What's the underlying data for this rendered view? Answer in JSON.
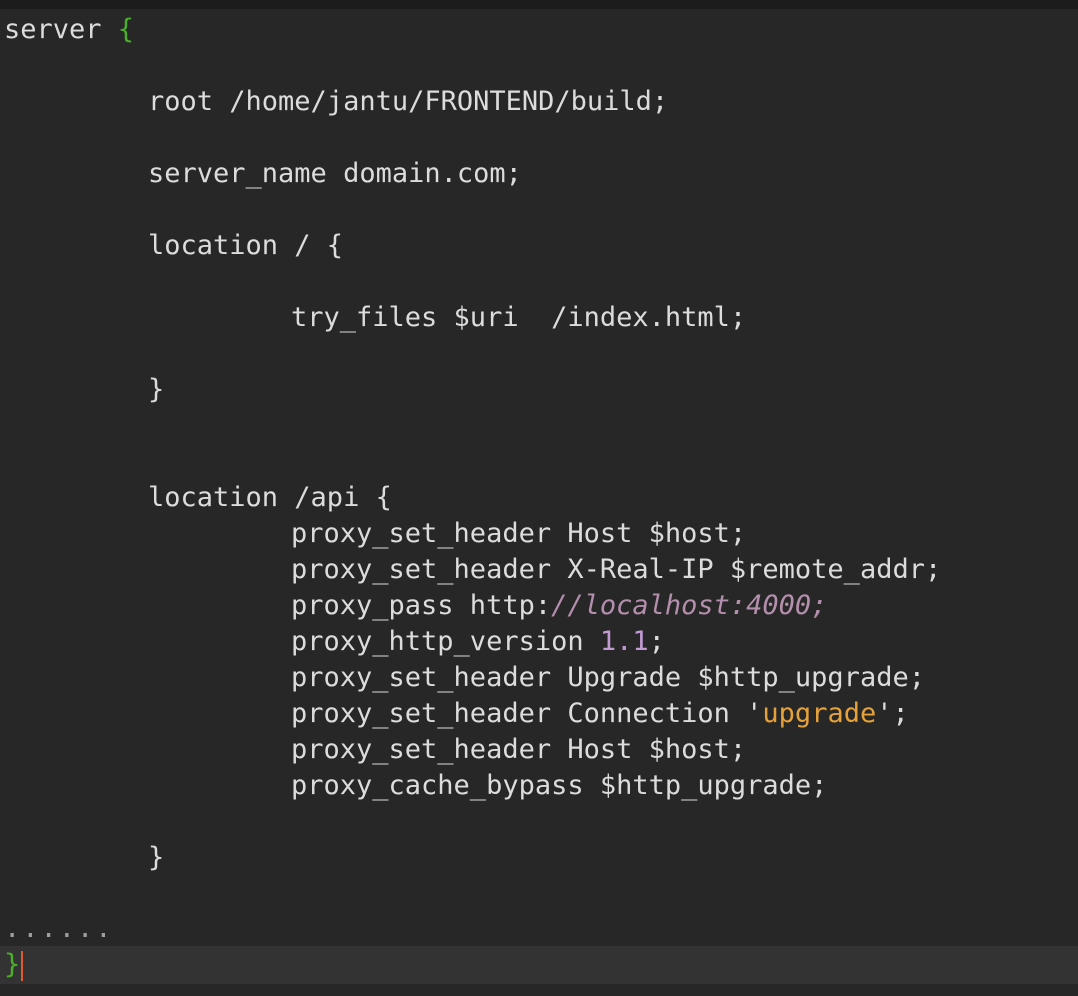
{
  "colors": {
    "background": "#272727",
    "current_line": "#333333",
    "text": "#dcdcdc",
    "brace_accent": "#4caf2a",
    "number": "#c39bd3",
    "comment": "#b48ead",
    "string": "#e6a23a",
    "cursor": "#e05a2a"
  },
  "code": {
    "line_server": "server ",
    "line_server_brace": "{",
    "line_root": "root /home/jantu/FRONTEND/build;",
    "line_server_name": "server_name domain.com;",
    "line_location_root": "location / {",
    "line_try_files": "try_files $uri  /index.html;",
    "line_close_1": "}",
    "line_location_api": "location /api {",
    "line_host_1": "proxy_set_header Host $host;",
    "line_real_ip": "proxy_set_header X-Real-IP $remote_addr;",
    "line_proxy_pass_prefix": "proxy_pass http:",
    "line_proxy_pass_comment": "//localhost:4000;",
    "line_http_version_prefix": "proxy_http_version ",
    "line_http_version_value": "1.1",
    "line_http_version_suffix": ";",
    "line_upgrade": "proxy_set_header Upgrade $http_upgrade;",
    "line_connection_prefix": "proxy_set_header Connection ",
    "line_connection_quote_open": "'",
    "line_connection_value": "upgrade",
    "line_connection_quote_close": "'",
    "line_connection_suffix": ";",
    "line_host_2": "proxy_set_header Host $host;",
    "line_cache_bypass": "proxy_cache_bypass $http_upgrade;",
    "line_close_2": "}",
    "line_ellipsis": "......",
    "line_final_brace": "}"
  }
}
